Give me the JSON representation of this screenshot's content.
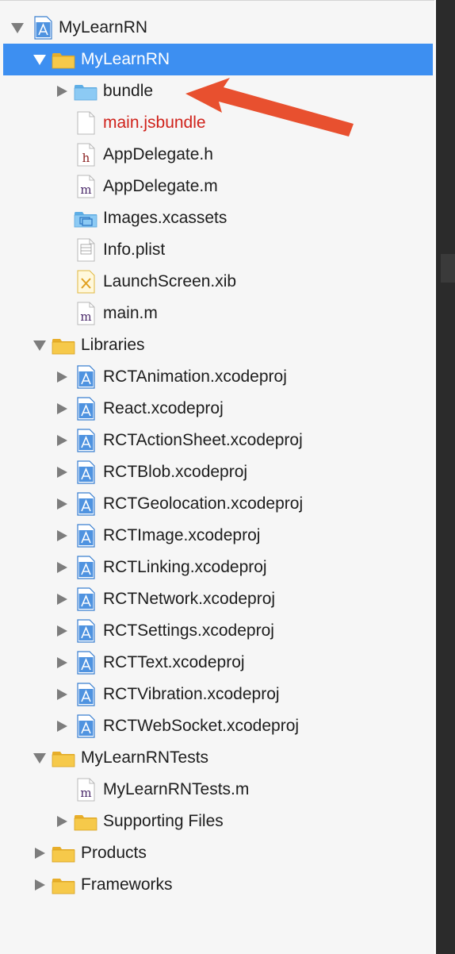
{
  "navigator": {
    "items": [
      {
        "label": "MyLearnRN",
        "kind": "project",
        "level": 0,
        "disclosure": "expanded",
        "selected": false
      },
      {
        "label": "MyLearnRN",
        "kind": "group",
        "level": 1,
        "disclosure": "expanded",
        "selected": true
      },
      {
        "label": "bundle",
        "kind": "folder-blue",
        "level": 2,
        "disclosure": "collapsed",
        "selected": false
      },
      {
        "label": "main.jsbundle",
        "kind": "blank-file",
        "level": 2,
        "disclosure": "none",
        "selected": false,
        "missing": true
      },
      {
        "label": "AppDelegate.h",
        "kind": "header-file",
        "level": 2,
        "disclosure": "none",
        "selected": false
      },
      {
        "label": "AppDelegate.m",
        "kind": "m-file",
        "level": 2,
        "disclosure": "none",
        "selected": false
      },
      {
        "label": "Images.xcassets",
        "kind": "assets",
        "level": 2,
        "disclosure": "none",
        "selected": false
      },
      {
        "label": "Info.plist",
        "kind": "plist",
        "level": 2,
        "disclosure": "none",
        "selected": false
      },
      {
        "label": "LaunchScreen.xib",
        "kind": "xib",
        "level": 2,
        "disclosure": "none",
        "selected": false
      },
      {
        "label": "main.m",
        "kind": "m-file",
        "level": 2,
        "disclosure": "none",
        "selected": false
      },
      {
        "label": "Libraries",
        "kind": "group",
        "level": 1,
        "disclosure": "expanded",
        "selected": false
      },
      {
        "label": "RCTAnimation.xcodeproj",
        "kind": "project",
        "level": 2,
        "disclosure": "collapsed",
        "selected": false
      },
      {
        "label": "React.xcodeproj",
        "kind": "project",
        "level": 2,
        "disclosure": "collapsed",
        "selected": false
      },
      {
        "label": "RCTActionSheet.xcodeproj",
        "kind": "project",
        "level": 2,
        "disclosure": "collapsed",
        "selected": false
      },
      {
        "label": "RCTBlob.xcodeproj",
        "kind": "project",
        "level": 2,
        "disclosure": "collapsed",
        "selected": false
      },
      {
        "label": "RCTGeolocation.xcodeproj",
        "kind": "project",
        "level": 2,
        "disclosure": "collapsed",
        "selected": false
      },
      {
        "label": "RCTImage.xcodeproj",
        "kind": "project",
        "level": 2,
        "disclosure": "collapsed",
        "selected": false
      },
      {
        "label": "RCTLinking.xcodeproj",
        "kind": "project",
        "level": 2,
        "disclosure": "collapsed",
        "selected": false
      },
      {
        "label": "RCTNetwork.xcodeproj",
        "kind": "project",
        "level": 2,
        "disclosure": "collapsed",
        "selected": false
      },
      {
        "label": "RCTSettings.xcodeproj",
        "kind": "project",
        "level": 2,
        "disclosure": "collapsed",
        "selected": false
      },
      {
        "label": "RCTText.xcodeproj",
        "kind": "project",
        "level": 2,
        "disclosure": "collapsed",
        "selected": false
      },
      {
        "label": "RCTVibration.xcodeproj",
        "kind": "project",
        "level": 2,
        "disclosure": "collapsed",
        "selected": false
      },
      {
        "label": "RCTWebSocket.xcodeproj",
        "kind": "project",
        "level": 2,
        "disclosure": "collapsed",
        "selected": false
      },
      {
        "label": "MyLearnRNTests",
        "kind": "group",
        "level": 1,
        "disclosure": "expanded",
        "selected": false
      },
      {
        "label": "MyLearnRNTests.m",
        "kind": "m-file",
        "level": 2,
        "disclosure": "none",
        "selected": false
      },
      {
        "label": "Supporting Files",
        "kind": "group",
        "level": 2,
        "disclosure": "collapsed",
        "selected": false
      },
      {
        "label": "Products",
        "kind": "group",
        "level": 1,
        "disclosure": "collapsed",
        "selected": false
      },
      {
        "label": "Frameworks",
        "kind": "group",
        "level": 1,
        "disclosure": "collapsed",
        "selected": false
      }
    ]
  },
  "annotation": {
    "color": "#e8502f",
    "points_to": "bundle"
  },
  "colors": {
    "selection": "#3d8ff1",
    "missing_file_text": "#d0221b",
    "folder_yellow": "#f5c242",
    "folder_blue": "#7cc2f2"
  }
}
